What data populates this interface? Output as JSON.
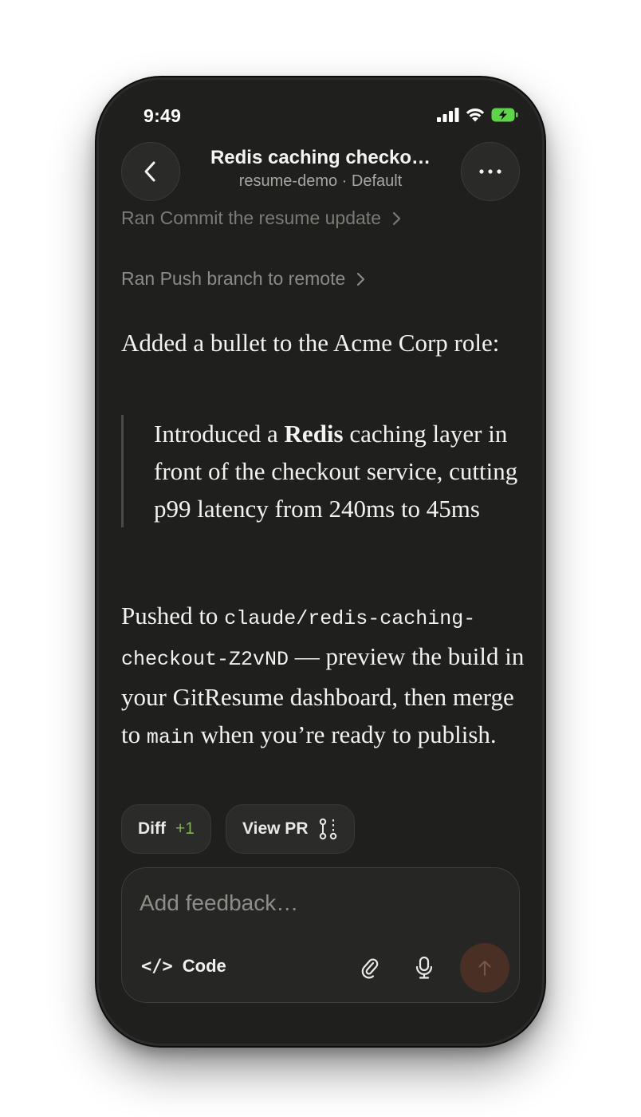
{
  "status": {
    "time": "9:49"
  },
  "header": {
    "title": "Redis caching checko…",
    "subtitle": "resume-demo · Default"
  },
  "steps": [
    {
      "label": "Ran Commit the resume update"
    },
    {
      "label": "Ran Push branch to remote"
    }
  ],
  "message": {
    "intro": "Added a bullet to the Acme Corp role:",
    "quote": {
      "before": "Introduced a ",
      "bold": "Redis",
      "after": " caching layer in front of the checkout service, cutting p99 latency from 240ms to 45ms"
    },
    "outro": {
      "prefix": "Pushed to ",
      "branch": "claude/redis-caching-checkout-Z2vND",
      "middle": " — preview the build in your GitResume dashboard, then merge to ",
      "target": "main",
      "suffix": " when you’re ready to publish."
    }
  },
  "chips": {
    "diff_label": "Diff",
    "diff_count": "+1",
    "pr_label": "View PR"
  },
  "composer": {
    "placeholder": "Add feedback…",
    "code_glyph": "</>",
    "code_label": "Code"
  },
  "colors": {
    "background": "#1f1f1e",
    "accent_send": "#4a2f24",
    "diff_green": "#7db257"
  },
  "icons": [
    "back-arrow-icon",
    "more-icon",
    "chevron-right-icon",
    "git-pr-icon",
    "code-icon",
    "paperclip-icon",
    "microphone-icon",
    "arrow-up-icon",
    "signal-icon",
    "wifi-icon",
    "battery-icon"
  ]
}
